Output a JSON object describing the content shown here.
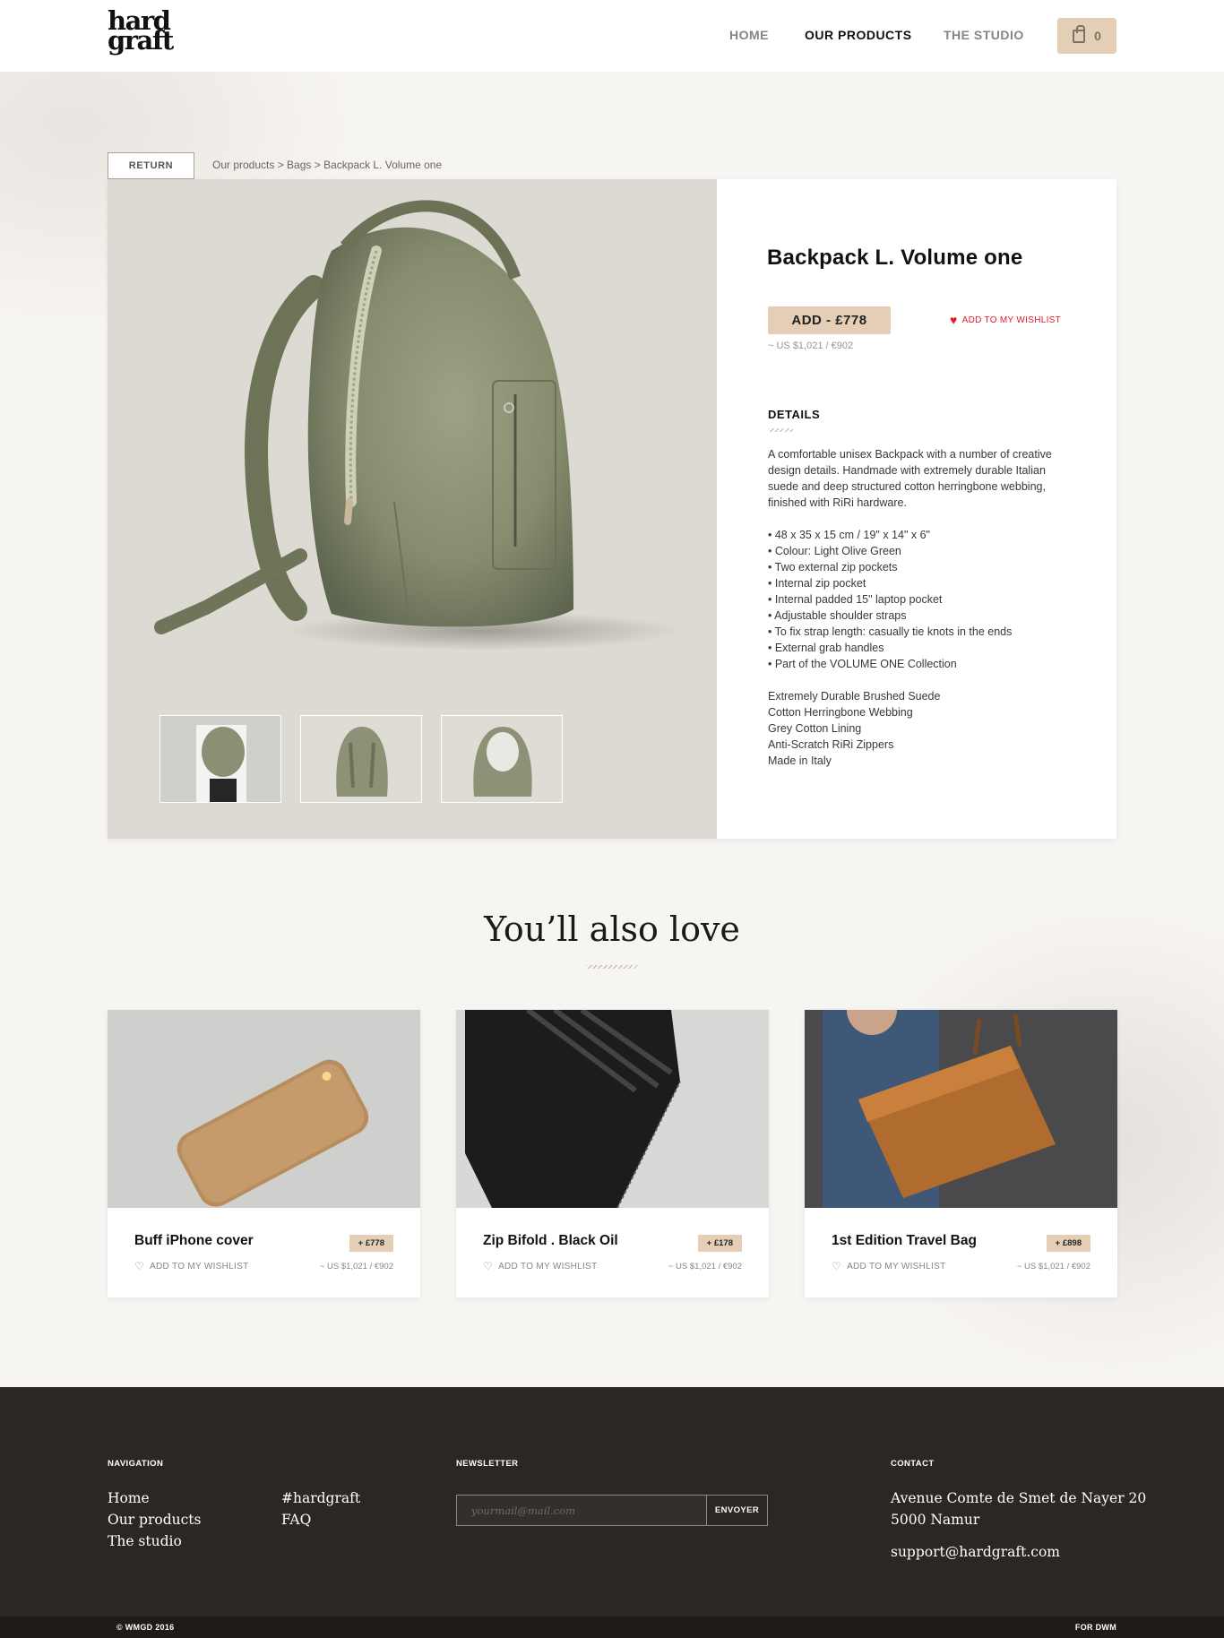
{
  "brand": {
    "logo_line1": "hard",
    "logo_line2": "graft"
  },
  "nav": {
    "home": "HOME",
    "products": "OUR PRODUCTS",
    "studio": "THE STUDIO",
    "cart_count": "0"
  },
  "breadcrumb": {
    "return_label": "RETURN",
    "path": "Our products > Bags > Backpack L. Volume one"
  },
  "product": {
    "title": "Backpack L. Volume one",
    "add_label": "ADD - £778",
    "conversion": "~ US  $1,021 / €902",
    "wishlist_label": "ADD TO MY WISHLIST",
    "details_title": "DETAILS",
    "description": "A comfortable unisex Backpack with a number of creative design details. Handmade with extremely durable Italian suede and deep structured cotton herringbone webbing, finished with RiRi hardware.",
    "features": [
      "• 48 x 35 x 15 cm / 19\" x 14\" x 6\"",
      "• Colour: Light Olive Green",
      "• Two external zip pockets",
      "• Internal zip pocket",
      "• Internal padded 15\" laptop pocket",
      "• Adjustable shoulder straps",
      "• To fix strap length: casually tie knots in the ends",
      "• External grab handles",
      "• Part of the VOLUME ONE Collection"
    ],
    "materials": [
      "Extremely Durable Brushed Suede",
      "Cotton Herringbone Webbing",
      "Grey Cotton Lining",
      "Anti-Scratch RiRi Zippers",
      "Made in Italy"
    ]
  },
  "also_love": {
    "title": "You’ll also love",
    "items": [
      {
        "title": "Buff iPhone cover",
        "price": "+ £778",
        "wishlist": "ADD TO MY WISHLIST",
        "conversion": "~ US  $1,021 / €902"
      },
      {
        "title": "Zip Bifold . Black Oil",
        "price": "+ £178",
        "wishlist": "ADD TO MY WISHLIST",
        "conversion": "~ US  $1,021 / €902"
      },
      {
        "title": "1st Edition Travel Bag",
        "price": "+ £898",
        "wishlist": "ADD TO MY WISHLIST",
        "conversion": "~ US  $1,021 / €902"
      }
    ]
  },
  "footer": {
    "nav_title": "NAVIGATION",
    "nav_links": [
      "Home",
      "Our products",
      "The studio"
    ],
    "nav_links2": [
      "#hardgraft",
      "FAQ"
    ],
    "newsletter_title": "NEWSLETTER",
    "newsletter_placeholder": "yourmail@mail.com",
    "newsletter_button": "ENVOYER",
    "contact_title": "CONTACT",
    "address_line1": "Avenue Comte de Smet de Nayer 20",
    "address_line2": "5000 Namur",
    "email": "support@hardgraft.com",
    "copyright": "© WMGD 2016",
    "credit": "FOR DWM"
  },
  "colors": {
    "accent": "#e4cfb6",
    "wishlist_red": "#e01b24",
    "footer_bg": "#2b2724"
  }
}
